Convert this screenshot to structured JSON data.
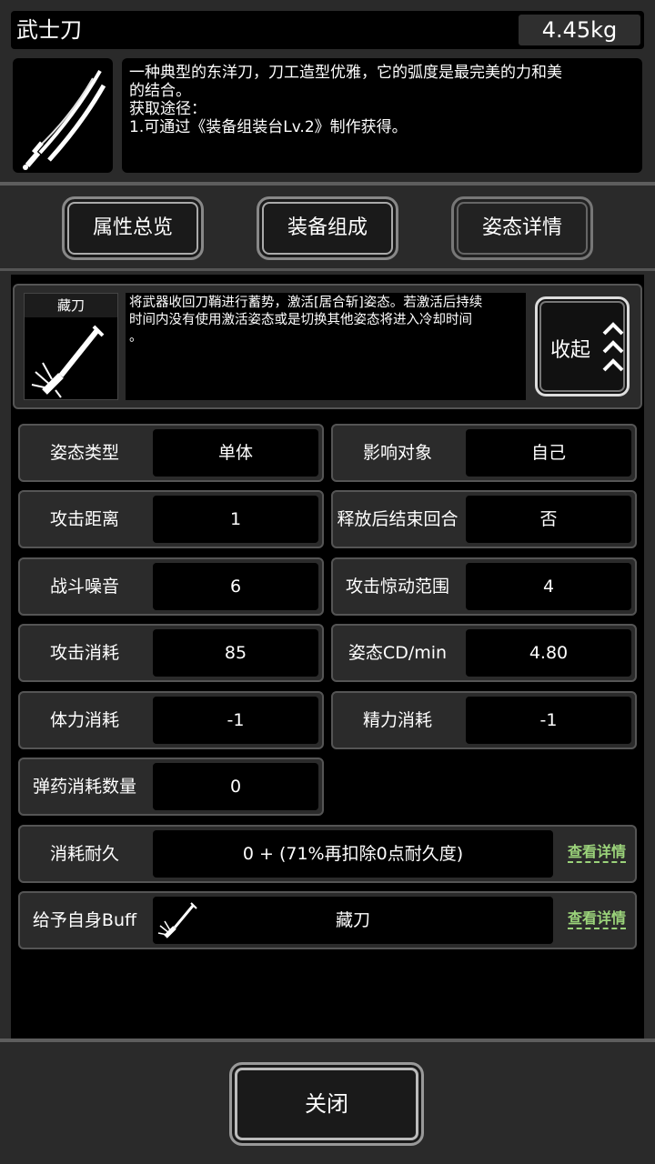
{
  "item": {
    "name": "武士刀",
    "weight": "4.45kg",
    "description_lines": [
      "一种典型的东洋刀，刀工造型优雅，它的弧度是最完美的力和美",
      "的结合。",
      "获取途径：",
      "1.可通过《装备组装台Lv.2》制作获得。"
    ]
  },
  "tabs": [
    {
      "label": "属性总览",
      "active": false
    },
    {
      "label": "装备组成",
      "active": false
    },
    {
      "label": "姿态详情",
      "active": true
    }
  ],
  "stance": {
    "name": "藏刀",
    "description_lines": [
      "将武器收回刀鞘进行蓄势，激活[居合斩]姿态。若激活后持续",
      "时间内没有使用激活姿态或是切换其他姿态将进入冷却时间",
      "。"
    ],
    "collapse_label": "收起"
  },
  "stats": [
    {
      "label": "姿态类型",
      "value": "单体"
    },
    {
      "label": "影响对象",
      "value": "自己"
    },
    {
      "label": "攻击距离",
      "value": "1"
    },
    {
      "label": "释放后结束回合",
      "value": "否"
    },
    {
      "label": "战斗噪音",
      "value": "6"
    },
    {
      "label": "攻击惊动范围",
      "value": "4"
    },
    {
      "label": "攻击消耗",
      "value": "85"
    },
    {
      "label": "姿态CD/min",
      "value": "4.80"
    },
    {
      "label": "体力消耗",
      "value": "-1"
    },
    {
      "label": "精力消耗",
      "value": "-1"
    },
    {
      "label": "弹药消耗数量",
      "value": "0"
    }
  ],
  "durability": {
    "label": "消耗耐久",
    "value": "0 + (71%再扣除0点耐久度)",
    "link": "查看详情"
  },
  "buff": {
    "label": "给予自身Buff",
    "value": "藏刀",
    "link": "查看详情"
  },
  "close_label": "关闭",
  "colors": {
    "background": "#2b2b2b",
    "panel": "#000000",
    "link": "#9bd37a"
  }
}
